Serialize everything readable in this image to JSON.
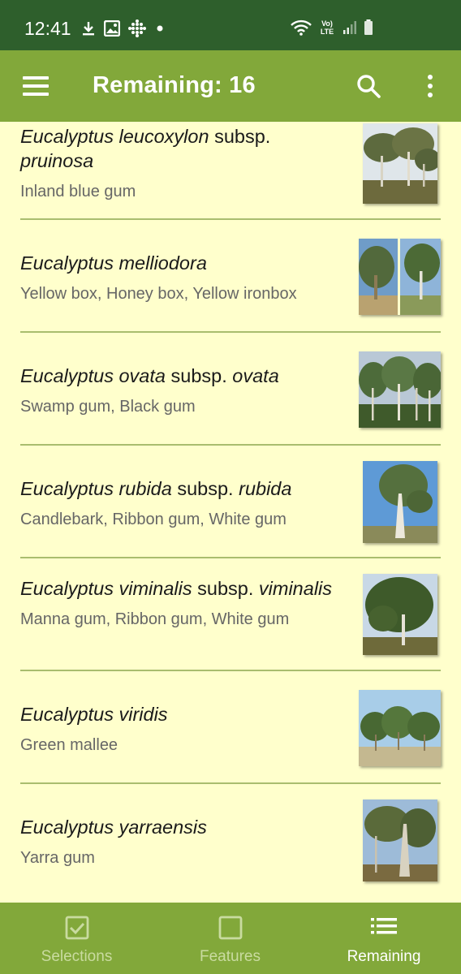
{
  "status_bar": {
    "time": "12:41",
    "left_icons": [
      "download-icon",
      "image-icon",
      "dots-grid-icon",
      "dot-icon"
    ],
    "right_icons": [
      "wifi-icon",
      "volte-icon",
      "signal-icon",
      "battery-icon"
    ],
    "volte_label_top": "Vo)",
    "volte_label_bottom": "LTE"
  },
  "app_bar": {
    "title": "Remaining: 16",
    "menu_icon": "hamburger-menu-icon",
    "search_icon": "search-icon",
    "more_icon": "more-vert-icon"
  },
  "species": [
    {
      "genus": "Eucalyptus",
      "epithet": "leucoxylon",
      "rank": "subsp.",
      "infra": "pruinosa",
      "common": "Inland blue gum"
    },
    {
      "genus": "Eucalyptus",
      "epithet": "melliodora",
      "rank": "",
      "infra": "",
      "common": "Yellow box, Honey box, Yellow ironbox"
    },
    {
      "genus": "Eucalyptus",
      "epithet": "ovata",
      "rank": "subsp.",
      "infra": "ovata",
      "common": "Swamp gum, Black gum"
    },
    {
      "genus": "Eucalyptus",
      "epithet": "rubida",
      "rank": "subsp.",
      "infra": "rubida",
      "common": "Candlebark, Ribbon gum, White gum"
    },
    {
      "genus": "Eucalyptus",
      "epithet": "viminalis",
      "rank": "subsp.",
      "infra": "viminalis",
      "common": "Manna gum, Ribbon gum, White gum"
    },
    {
      "genus": "Eucalyptus",
      "epithet": "viridis",
      "rank": "",
      "infra": "",
      "common": "Green mallee"
    },
    {
      "genus": "Eucalyptus",
      "epithet": "yarraensis",
      "rank": "",
      "infra": "",
      "common": "Yarra gum"
    }
  ],
  "bottom_nav": [
    {
      "label": "Selections",
      "icon": "checkbox-checked-icon",
      "active": false
    },
    {
      "label": "Features",
      "icon": "checkbox-empty-icon",
      "active": false
    },
    {
      "label": "Remaining",
      "icon": "list-icon",
      "active": true
    }
  ],
  "colors": {
    "status_bar": "#2e5f2c",
    "app_bar": "#82a83a",
    "background": "#ffffcc",
    "divider": "#a9bd6e",
    "nav_inactive": "#c9dba0"
  }
}
